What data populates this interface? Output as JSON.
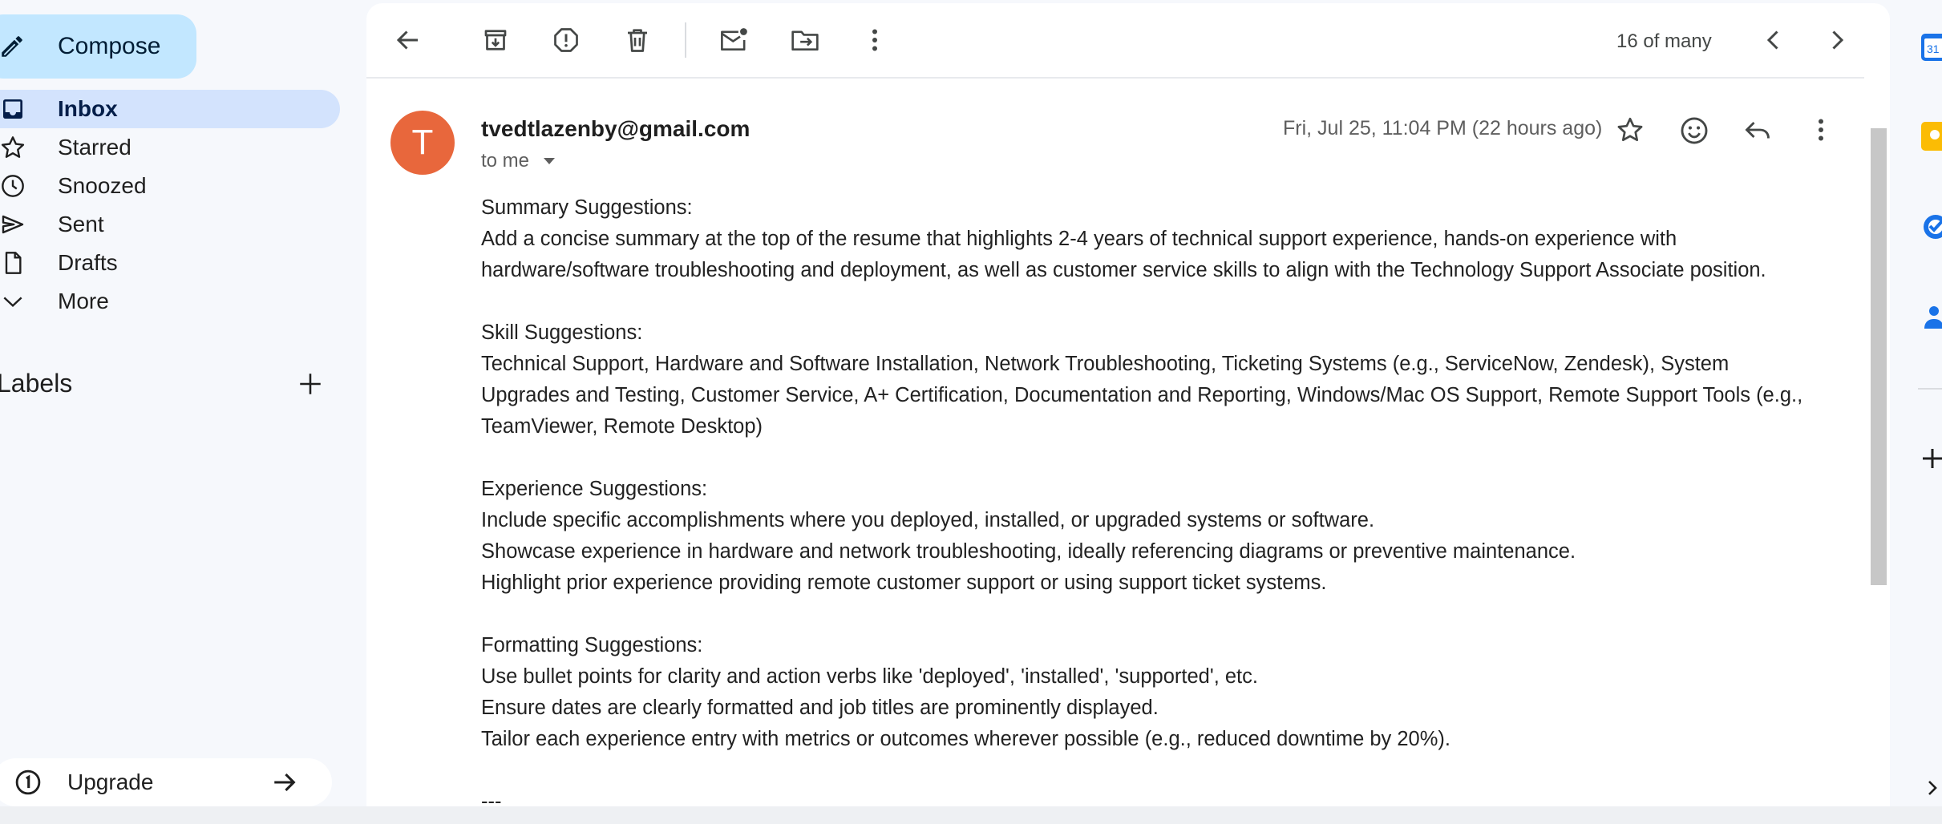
{
  "sidebar": {
    "compose_label": "Compose",
    "items": [
      {
        "label": "Inbox",
        "active": true
      },
      {
        "label": "Starred"
      },
      {
        "label": "Snoozed"
      },
      {
        "label": "Sent"
      },
      {
        "label": "Drafts"
      },
      {
        "label": "More"
      }
    ],
    "labels_heading": "Labels",
    "upgrade_label": "Upgrade"
  },
  "toolbar": {
    "pager_text": "16 of many",
    "icons": [
      "back-arrow-icon",
      "archive-icon",
      "report-spam-icon",
      "delete-icon",
      "mark-unread-icon",
      "move-to-icon",
      "more-vert-icon",
      "chevron-left-icon",
      "chevron-right-icon"
    ]
  },
  "email": {
    "avatar_letter": "T",
    "sender": "tvedtlazenby@gmail.com",
    "to": "to me",
    "date": "Fri, Jul 25, 11:04 PM (22 hours ago)",
    "paragraphs": [
      [
        "Summary Suggestions:",
        "Add a concise summary at the top of the resume that highlights 2-4 years of technical support experience, hands-on experience with",
        "hardware/software troubleshooting and deployment, as well as customer service skills to align with the Technology Support Associate position."
      ],
      [
        "Skill Suggestions:",
        "Technical Support, Hardware and Software Installation, Network Troubleshooting, Ticketing Systems (e.g., ServiceNow, Zendesk), System",
        "Upgrades and Testing, Customer Service, A+ Certification, Documentation and Reporting, Windows/Mac OS Support, Remote Support Tools (e.g.,",
        "TeamViewer, Remote Desktop)"
      ],
      [
        "Experience Suggestions:",
        "Include specific accomplishments where you deployed, installed, or upgraded systems or software.",
        "Showcase experience in hardware and network troubleshooting, ideally referencing diagrams or preventive maintenance.",
        "Highlight prior experience providing remote customer support or using support ticket systems."
      ],
      [
        "Formatting Suggestions:",
        "Use bullet points for clarity and action verbs like 'deployed', 'installed', 'supported', etc.",
        "Ensure dates are clearly formatted and job titles are prominently displayed.",
        "Tailor each experience entry with metrics or outcomes wherever possible (e.g., reduced downtime by 20%)."
      ],
      [
        "---"
      ]
    ]
  },
  "colors": {
    "avatar_bg": "#e8673c",
    "compose_bg": "#c2e7ff",
    "active_nav_bg": "#d3e3fd",
    "page_bg": "#f6f8fc"
  },
  "right_panel": {
    "icons": [
      "calendar-icon",
      "keep-icon",
      "tasks-icon",
      "contacts-icon",
      "add-icon",
      "expand-icon"
    ],
    "calendar_text": "31"
  }
}
